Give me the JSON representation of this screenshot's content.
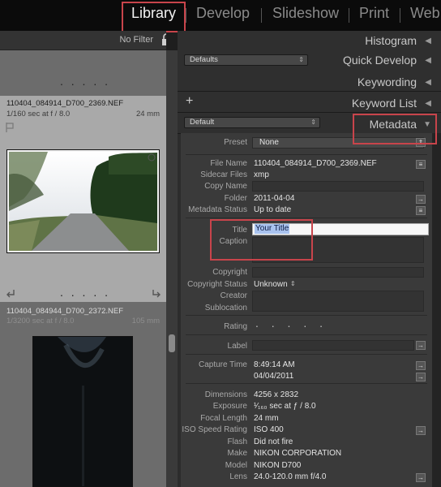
{
  "modules": {
    "items": [
      "Library",
      "Develop",
      "Slideshow",
      "Print",
      "Web"
    ],
    "active": "Library"
  },
  "filmstrip": {
    "filter_label": "No Filter",
    "cells": [
      {
        "name": "110404_084914_D700_2369.NEF",
        "exposure": "1/160 sec at f / 8.0",
        "focal": "24 mm"
      },
      {
        "name": "110404_084944_D700_2372.NEF",
        "exposure": "1/3200 sec at f / 8.0",
        "focal": "105 mm"
      }
    ],
    "dots": ". . . . ."
  },
  "panel": {
    "histogram": "Histogram",
    "quick_develop": "Quick Develop",
    "quick_develop_preset": "Defaults",
    "keywording": "Keywording",
    "keyword_list": "Keyword List",
    "metadata": "Metadata",
    "metadata_preset_dropdown": "Default"
  },
  "metadata": {
    "preset_label": "Preset",
    "preset_value": "None",
    "file_name_label": "File Name",
    "file_name": "110404_084914_D700_2369.NEF",
    "sidecar_label": "Sidecar Files",
    "sidecar": "xmp",
    "copy_name_label": "Copy Name",
    "folder_label": "Folder",
    "folder": "2011-04-04",
    "status_label": "Metadata Status",
    "status": "Up to date",
    "title_label": "Title",
    "title_value": "Your Title",
    "caption_label": "Caption",
    "copyright_label": "Copyright",
    "copyright_status_label": "Copyright Status",
    "copyright_status": "Unknown",
    "creator_label": "Creator",
    "sublocation_label": "Sublocation",
    "rating_label": "Rating",
    "rating_dots": ". . . . .",
    "label_label": "Label",
    "capture_time_label": "Capture Time",
    "capture_time": "8:49:14 AM",
    "capture_date": "04/04/2011",
    "dimensions_label": "Dimensions",
    "dimensions": "4256 x 2832",
    "exposure_label": "Exposure",
    "exposure": "¹⁄₁₆₀ sec at ƒ / 8.0",
    "focal_length_label": "Focal Length",
    "focal_length": "24 mm",
    "iso_label": "ISO Speed Rating",
    "iso": "ISO 400",
    "flash_label": "Flash",
    "flash": "Did not fire",
    "make_label": "Make",
    "make": "NIKON CORPORATION",
    "model_label": "Model",
    "model": "NIKON D700",
    "lens_label": "Lens",
    "lens": "24.0-120.0 mm f/4.0"
  },
  "colors": {
    "highlight_box": "#c8444b",
    "selection": "#a9c3ef"
  }
}
